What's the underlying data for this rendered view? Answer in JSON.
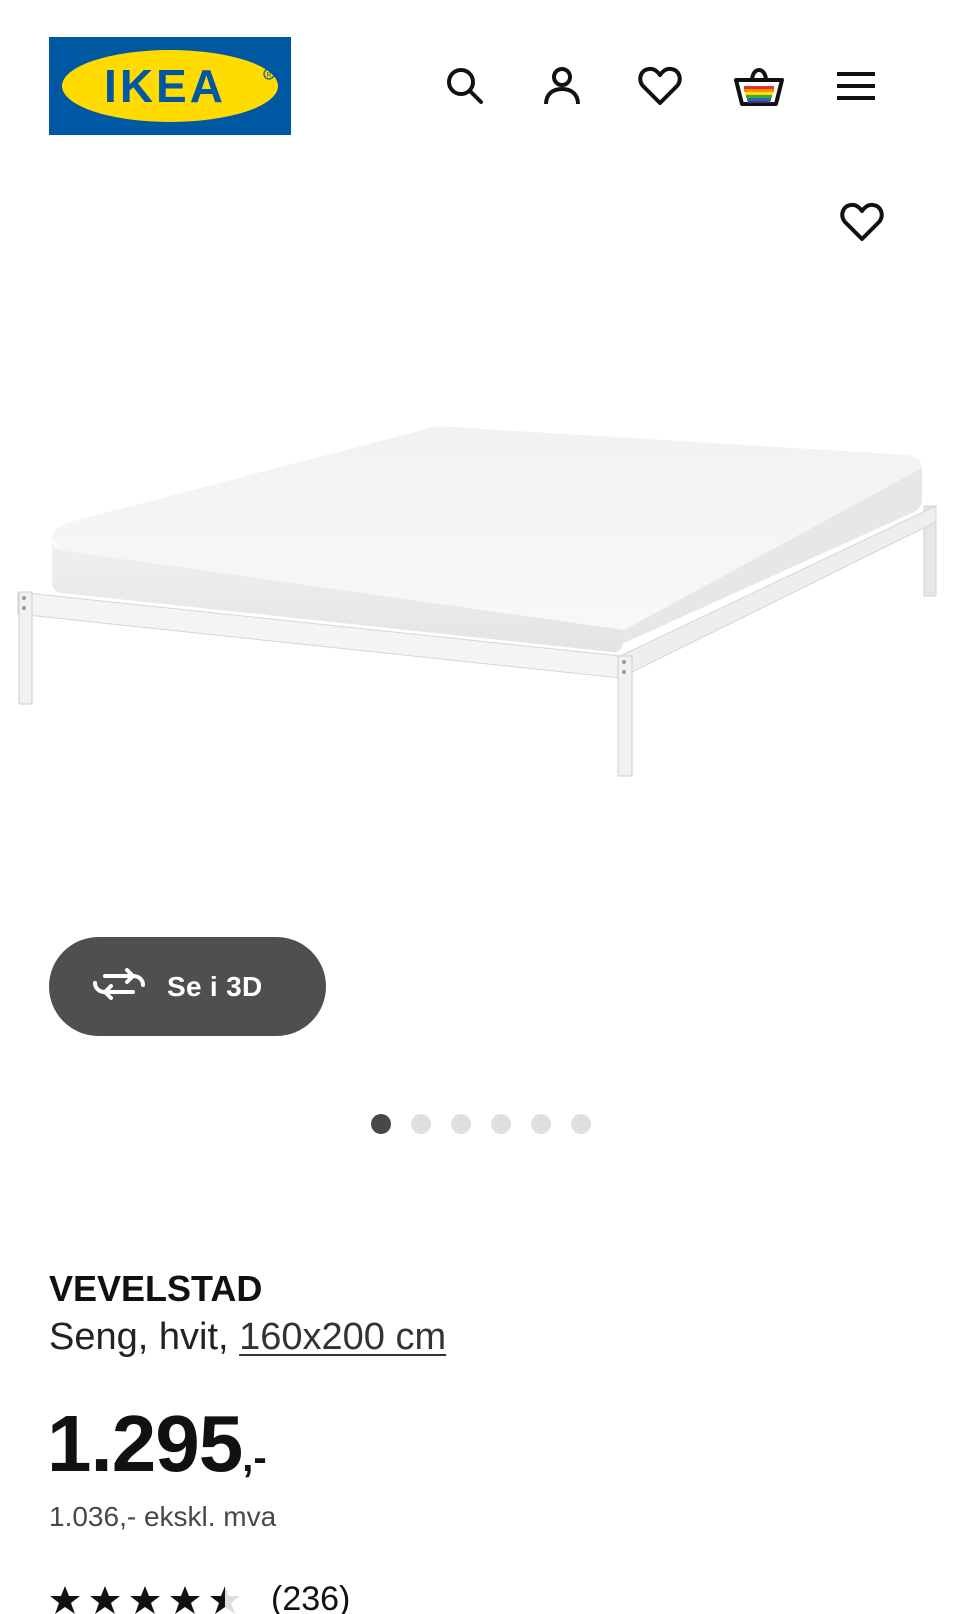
{
  "header": {
    "logo_text": "IKEA",
    "icons": [
      "search-icon",
      "user-icon",
      "heart-icon",
      "basket-icon",
      "menu-icon"
    ]
  },
  "product": {
    "favorite_icon": "heart-icon",
    "view_3d_label": "Se i 3D",
    "carousel": {
      "total": 6,
      "active_index": 0
    },
    "name": "VEVELSTAD",
    "description_prefix": "Seng, hvit, ",
    "size": "160x200 cm",
    "price_main": "1.295",
    "price_suffix": ",-",
    "price_ex_vat": "1.036,- ekskl. mva",
    "rating_value": 4.5,
    "rating_max": 5,
    "review_count": "(236)"
  },
  "colors": {
    "brand_blue": "#0058a3",
    "brand_yellow": "#ffdb00",
    "button_dark": "#4f4f4f"
  }
}
